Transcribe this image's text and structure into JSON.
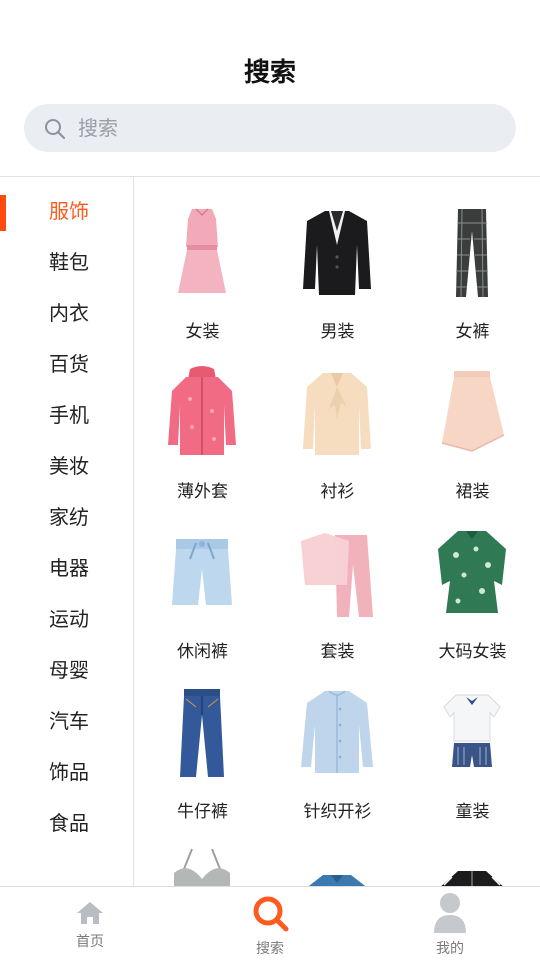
{
  "header": {
    "title": "搜索"
  },
  "search": {
    "placeholder": "搜索",
    "value": ""
  },
  "sidebar": {
    "items": [
      {
        "label": "服饰",
        "active": true
      },
      {
        "label": "鞋包"
      },
      {
        "label": "内衣"
      },
      {
        "label": "百货"
      },
      {
        "label": "手机"
      },
      {
        "label": "美妆"
      },
      {
        "label": "家纺"
      },
      {
        "label": "电器"
      },
      {
        "label": "运动"
      },
      {
        "label": "母婴"
      },
      {
        "label": "汽车"
      },
      {
        "label": "饰品"
      },
      {
        "label": "食品"
      }
    ]
  },
  "grid": {
    "items": [
      {
        "label": "女装",
        "icon": "dress-icon"
      },
      {
        "label": "男装",
        "icon": "blazer-icon"
      },
      {
        "label": "女裤",
        "icon": "plaid-pants-icon"
      },
      {
        "label": "薄外套",
        "icon": "jacket-icon"
      },
      {
        "label": "衬衫",
        "icon": "blouse-icon"
      },
      {
        "label": "裙装",
        "icon": "skirt-icon"
      },
      {
        "label": "休闲裤",
        "icon": "shorts-icon"
      },
      {
        "label": "套装",
        "icon": "outfit-set-icon"
      },
      {
        "label": "大码女装",
        "icon": "floral-top-icon"
      },
      {
        "label": "牛仔裤",
        "icon": "jeans-icon"
      },
      {
        "label": "针织开衫",
        "icon": "cardigan-icon"
      },
      {
        "label": "童装",
        "icon": "kids-outfit-icon"
      }
    ],
    "partial_row_icons": [
      "bra-icon",
      "polo-shirt-icon",
      "track-jacket-icon"
    ]
  },
  "tabbar": {
    "tabs": [
      {
        "label": "首页",
        "icon": "home-icon"
      },
      {
        "label": "搜索",
        "icon": "search-icon",
        "active": true
      },
      {
        "label": "我的",
        "icon": "profile-icon"
      }
    ]
  },
  "colors": {
    "accent": "#ff5a1f",
    "search_bg": "#eaedf1",
    "divider": "#e2e2e2"
  }
}
